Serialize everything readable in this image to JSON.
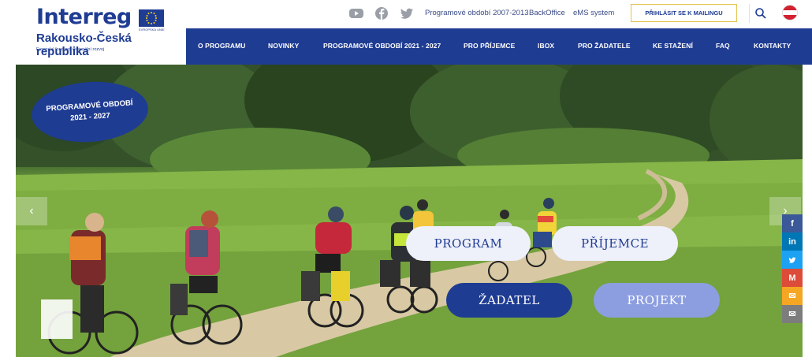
{
  "logo": {
    "wordmark": "Interreg",
    "region": "Rakousko-Česká republika",
    "tagline": "Evropský fond pro regionální rozvoj",
    "flag_caption": "EVROPSKÁ UNIE"
  },
  "topbar": {
    "social_icons": [
      "youtube-icon",
      "facebook-icon",
      "twitter-icon"
    ],
    "links": [
      "Programové období 2007-2013",
      "BackOffice",
      "eMS system"
    ],
    "mailing_button": "PŘIHLÁSIT SE K MAILINGU",
    "language": "AT",
    "colors": {
      "flag_red": "#d1202e",
      "flag_white": "#ffffff",
      "mail_border": "#e2c24a"
    }
  },
  "nav": {
    "items": [
      "O PROGRAMU",
      "NOVINKY",
      "PROGRAMOVÉ OBDOBÍ 2021 - 2027",
      "PRO PŘÍJEMCE",
      "IBOX",
      "PRO ŽADATELE",
      "KE STAŽENÍ",
      "FAQ",
      "KONTAKTY"
    ]
  },
  "hero": {
    "badge_line1": "PROGRAMOVÉ OBDOBÍ",
    "badge_line2": "2021 - 2027",
    "prev_arrow": "‹",
    "next_arrow": "›",
    "buttons": {
      "program": "PROGRAM",
      "prijemce": "PŘÍJEMCE",
      "zadatel": "ŽADATEL",
      "projekt": "PROJEKT"
    }
  },
  "share": [
    {
      "icon": "facebook-icon",
      "glyph": "f",
      "color": "#3b5998"
    },
    {
      "icon": "linkedin-icon",
      "glyph": "in",
      "color": "#0077b5"
    },
    {
      "icon": "twitter-icon",
      "glyph": "t",
      "color": "#1da1f2"
    },
    {
      "icon": "gmail-icon",
      "glyph": "M",
      "color": "#dd4b39"
    },
    {
      "icon": "message-icon",
      "glyph": "✉",
      "color": "#f5a623"
    },
    {
      "icon": "email-icon",
      "glyph": "✉",
      "color": "#7d7d7d"
    }
  ],
  "brand_color": "#1f3c93"
}
